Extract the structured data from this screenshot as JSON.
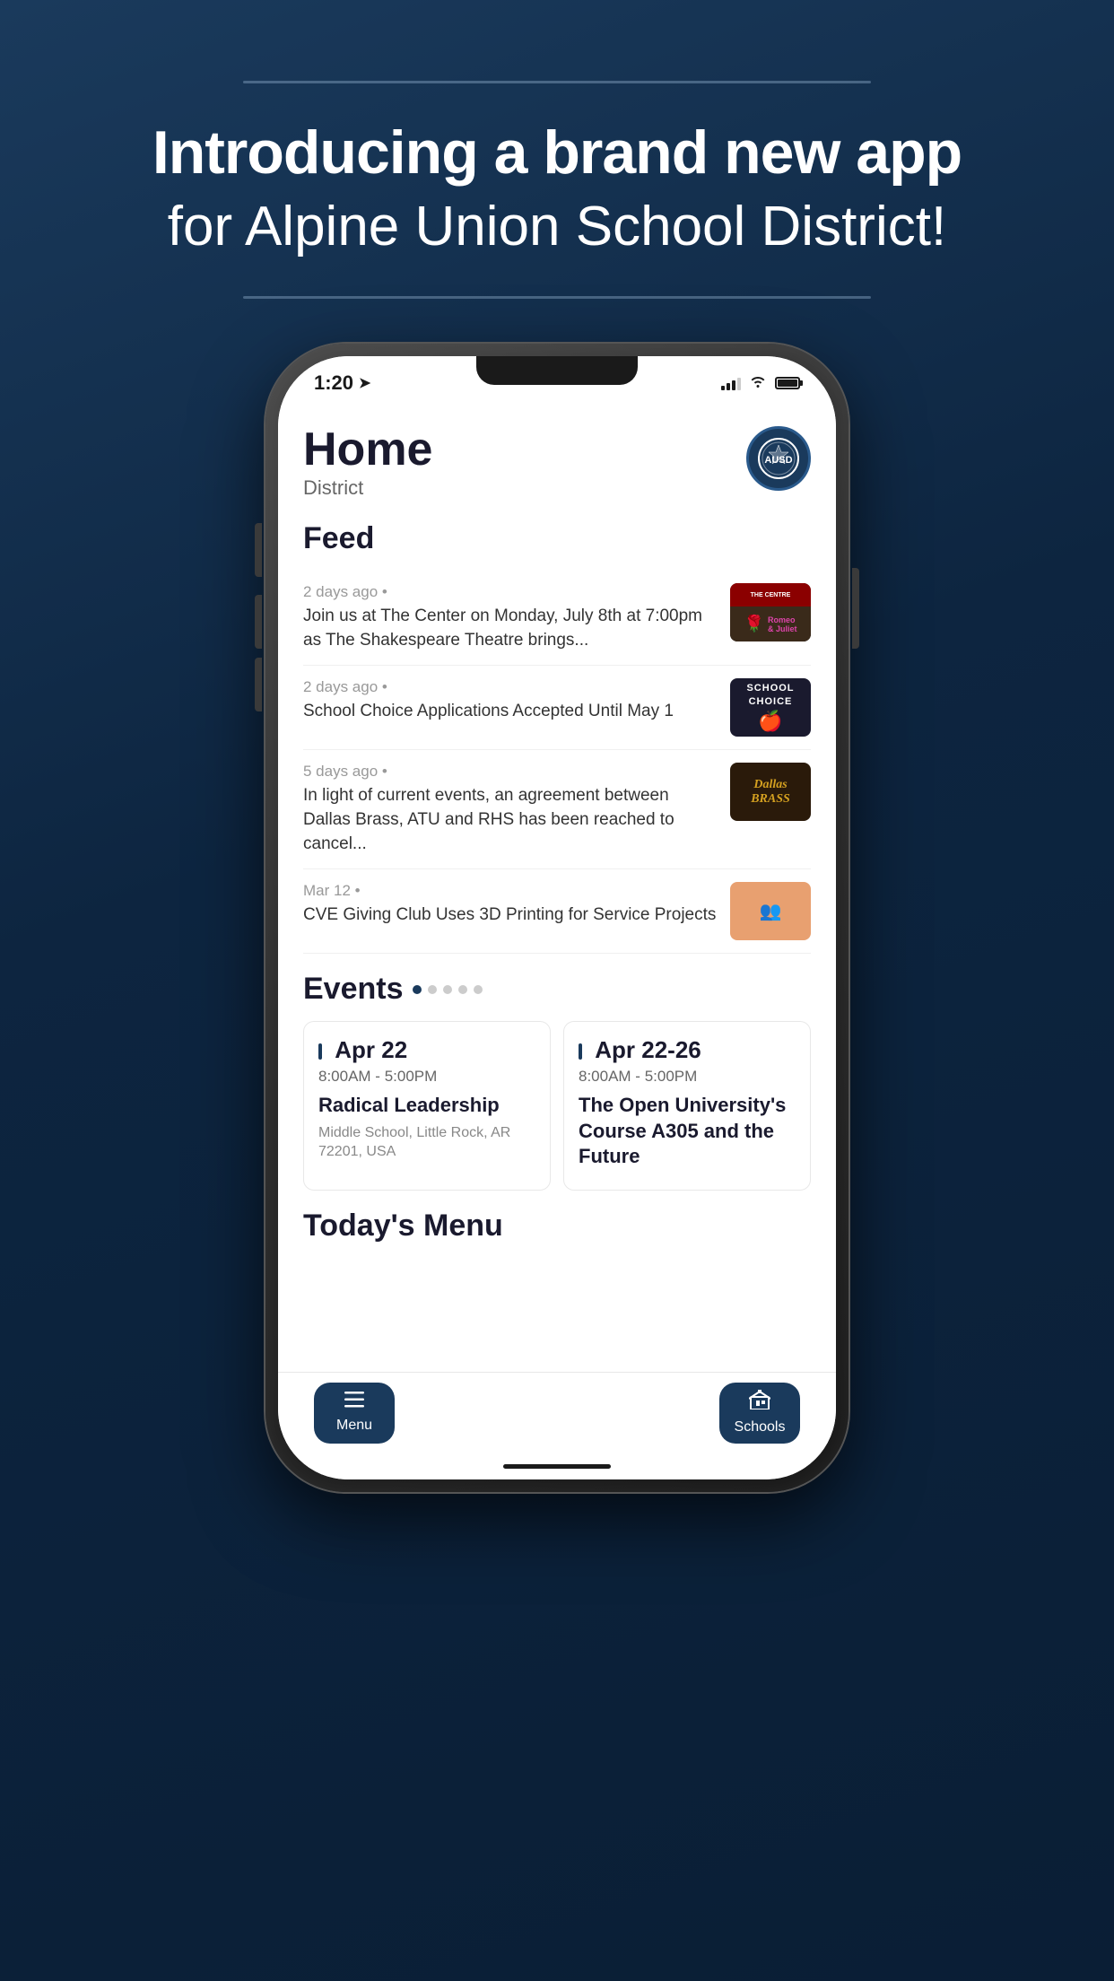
{
  "page": {
    "bg_headline_main": "Introducing a brand new app",
    "bg_headline_sub": "for Alpine Union School District!",
    "bg_accent_color": "#1a3a5c"
  },
  "phone": {
    "status_bar": {
      "time": "1:20",
      "location_arrow": "➤"
    },
    "app": {
      "title": "Home",
      "subtitle": "District",
      "logo_alt": "Alpine Union School District logo"
    },
    "feed": {
      "section_title": "Feed",
      "items": [
        {
          "time": "2 days ago",
          "text": "Join us at The Center on Monday, July 8th at 7:00pm as The Shakespeare Theatre brings...",
          "thumb_type": "shakespeare"
        },
        {
          "time": "2 days ago",
          "text": "School Choice Applications Accepted Until May 1",
          "thumb_type": "school_choice"
        },
        {
          "time": "5 days ago",
          "text": "In light of current events, an agreement between Dallas Brass, ATU and RHS has been reached to cancel...",
          "thumb_type": "dallas_brass"
        },
        {
          "time": "Mar 12",
          "text": "CVE Giving Club Uses 3D Printing for Service Projects",
          "thumb_type": "cve"
        }
      ]
    },
    "events": {
      "section_title": "Events",
      "dots": [
        true,
        false,
        false,
        false,
        false
      ],
      "cards": [
        {
          "date": "Apr 22",
          "time": "8:00AM - 5:00PM",
          "name": "Radical Leadership",
          "location": "Middle School, Little Rock, AR 72201, USA"
        },
        {
          "date": "Apr 22-26",
          "time": "8:00AM - 5:00PM",
          "name": "The Open University's Course A305 and the Future",
          "location": ""
        }
      ]
    },
    "todays_menu": {
      "section_title": "Today's Menu"
    },
    "bottom_nav": {
      "menu_label": "Menu",
      "schools_label": "Schools"
    }
  }
}
